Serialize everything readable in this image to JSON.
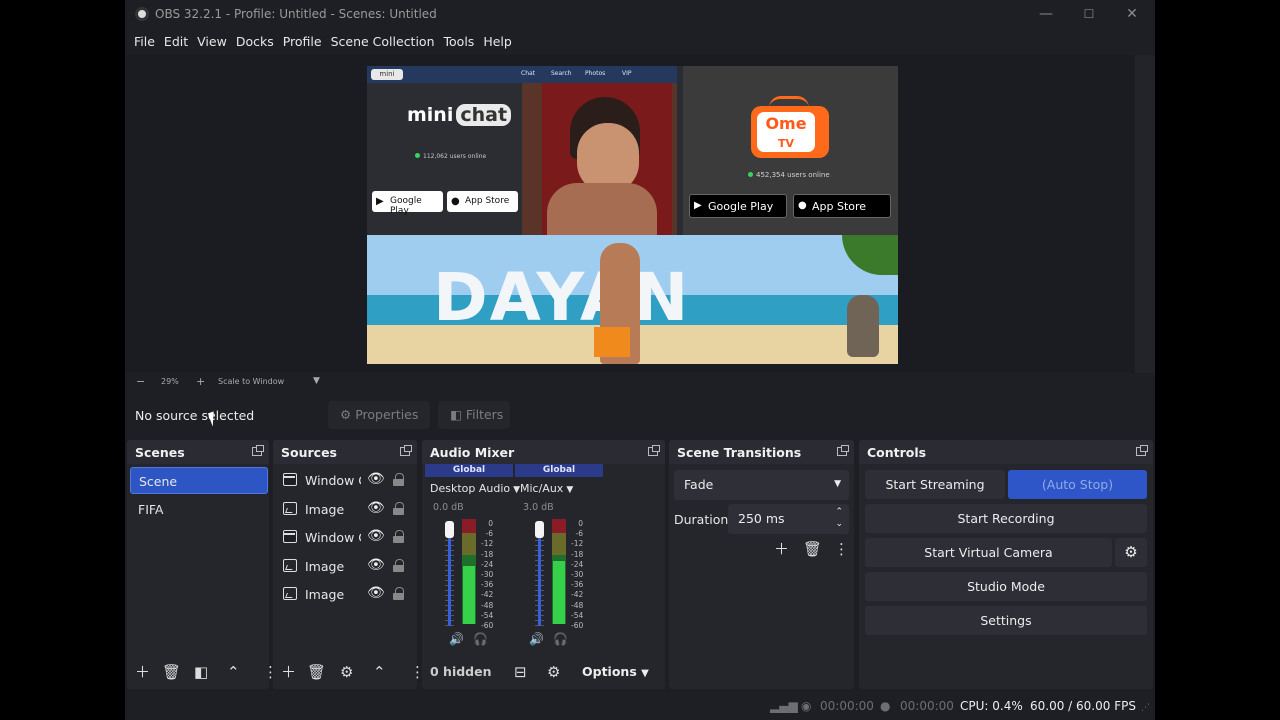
{
  "window": {
    "title": "OBS 32.2.1 - Profile: Untitled - Scenes: Untitled",
    "minimize": "—",
    "maximize": "☐",
    "close": "✕"
  },
  "menu": [
    "File",
    "Edit",
    "View",
    "Docks",
    "Profile",
    "Scene Collection",
    "Tools",
    "Help"
  ],
  "preview": {
    "minichat": {
      "nav": [
        "Chat",
        "Search",
        "Photos",
        "VIP"
      ],
      "brand_a": "mini",
      "brand_b": "chat",
      "users": "112,062 users online",
      "google_play": "Google Play",
      "app_store": "App Store"
    },
    "ometv": {
      "logo_top": "Ome",
      "logo_bottom": "TV",
      "users": "452,354 users online",
      "google_play": "Google Play",
      "app_store": "App Store"
    },
    "banner_text": "DAYAN"
  },
  "zoom": {
    "minus": "−",
    "value": "29%",
    "plus": "+",
    "mode": "Scale to Window"
  },
  "context": {
    "status": "No source selected",
    "properties": "Properties",
    "filters": "Filters"
  },
  "scenes": {
    "title": "Scenes",
    "items": [
      "Scene",
      "FIFA"
    ],
    "selected": "Scene"
  },
  "sources": {
    "title": "Sources",
    "items": [
      {
        "name": "Window Capture",
        "icon": "window-icon"
      },
      {
        "name": "Image",
        "icon": "image-icon"
      },
      {
        "name": "Window Capture",
        "icon": "window-icon"
      },
      {
        "name": "Image",
        "icon": "image-icon"
      },
      {
        "name": "Image",
        "icon": "image-icon"
      }
    ]
  },
  "mixer": {
    "title": "Audio Mixer",
    "channels": [
      {
        "global": "Global",
        "name": "Desktop Audio",
        "db": "0.0 dB",
        "level": 0.55
      },
      {
        "global": "Global",
        "name": "Mic/Aux",
        "db": "3.0 dB",
        "level": 0.6
      }
    ],
    "scale": [
      "0",
      "-6",
      "-12",
      "-18",
      "-24",
      "-30",
      "-36",
      "-42",
      "-48",
      "-54",
      "-60"
    ],
    "hidden": "0 hidden",
    "options": "Options"
  },
  "transitions": {
    "title": "Scene Transitions",
    "selected": "Fade",
    "duration_label": "Duration",
    "duration_value": "250 ms"
  },
  "controls": {
    "title": "Controls",
    "start_streaming": "Start Streaming",
    "auto_stop": "(Auto Stop)",
    "start_recording": "Start Recording",
    "start_virtual_camera": "Start Virtual Camera",
    "studio_mode": "Studio Mode",
    "settings": "Settings"
  },
  "status": {
    "stream_time": "00:00:00",
    "record_time": "00:00:00",
    "cpu": "CPU: 0.4%",
    "fps": "60.00 / 60.00 FPS"
  },
  "colors": {
    "accent_blue": "#2d55c4",
    "background": "#1e1f24",
    "dock": "#25262c",
    "meter_green": "#36d04a"
  }
}
